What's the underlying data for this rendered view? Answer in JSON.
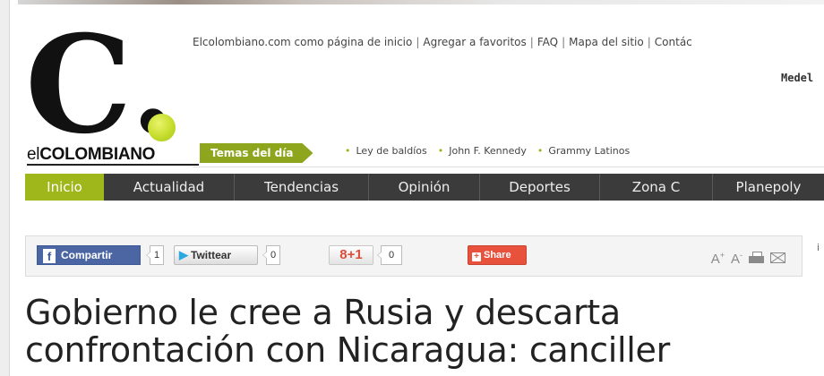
{
  "brand": {
    "logo_letter": "C.",
    "logo_prefix": "el",
    "logo_name": "COLOMBIANO",
    "accent_color": "#a0b71c",
    "ball_color": "#c5dd2c"
  },
  "utility_links": [
    "Elcolombiano.com como página de inicio",
    "Agregar a favoritos",
    "FAQ",
    "Mapa del sitio",
    "Contác"
  ],
  "city": "Medel",
  "temas": {
    "label": "Temas del día",
    "items": [
      "Ley de baldíos",
      "John F. Kennedy",
      "Grammy Latinos"
    ]
  },
  "nav": {
    "items": [
      {
        "label": "Inicio",
        "active": true
      },
      {
        "label": "Actualidad",
        "active": false
      },
      {
        "label": "Tendencias",
        "active": false
      },
      {
        "label": "Opinión",
        "active": false
      },
      {
        "label": "Deportes",
        "active": false
      },
      {
        "label": "Zona C",
        "active": false
      },
      {
        "label": "Planepoly",
        "active": false
      }
    ]
  },
  "share": {
    "facebook_label": "Compartir",
    "facebook_icon": "f",
    "facebook_count": "1",
    "twitter_label": "Twittear",
    "twitter_count": "0",
    "gplus_label": "8+1",
    "gplus_count": "0",
    "share_label": "Share",
    "font_larger": "A",
    "font_larger_sign": "+",
    "font_smaller": "A",
    "font_smaller_sign": "-"
  },
  "edge_mark": "i",
  "article": {
    "headline": "Gobierno le cree a Rusia y descarta confrontación con Nicaragua: canciller"
  }
}
